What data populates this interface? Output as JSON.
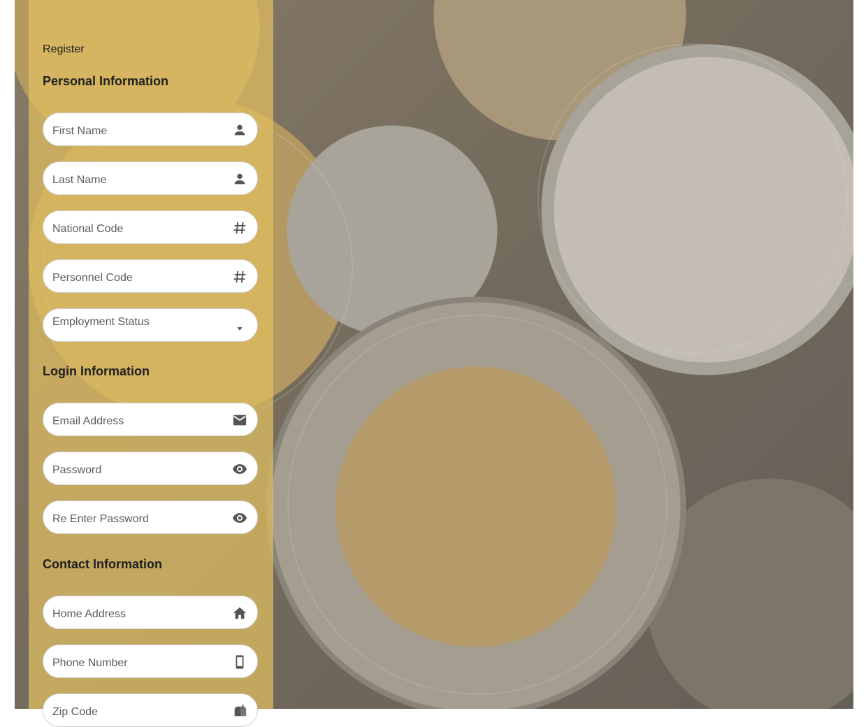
{
  "page": {
    "label": "Register"
  },
  "sections": {
    "personal": {
      "title": "Personal Information"
    },
    "login": {
      "title": "Login Information"
    },
    "contact": {
      "title": "Contact Information"
    }
  },
  "fields": {
    "first_name": {
      "label": "First Name",
      "icon": "person-icon"
    },
    "last_name": {
      "label": "Last Name",
      "icon": "person-icon"
    },
    "national_code": {
      "label": "National Code",
      "icon": "hash-icon"
    },
    "personnel_code": {
      "label": "Personnel Code",
      "icon": "hash-icon"
    },
    "employment_status": {
      "label": "Employment Status",
      "icon": "dropdown-arrow-icon"
    },
    "email": {
      "label": "Email Address",
      "icon": "mail-icon"
    },
    "password": {
      "label": "Password",
      "icon": "eye-icon"
    },
    "re_password": {
      "label": "Re Enter Password",
      "icon": "eye-icon"
    },
    "home_address": {
      "label": "Home Address",
      "icon": "home-icon"
    },
    "phone": {
      "label": "Phone Number",
      "icon": "phone-icon"
    },
    "zip": {
      "label": "Zip Code",
      "icon": "mailbox-icon"
    }
  },
  "colors": {
    "panel_overlay": "#e2bf60",
    "field_bg": "#ffffff",
    "icon": "#555555"
  }
}
